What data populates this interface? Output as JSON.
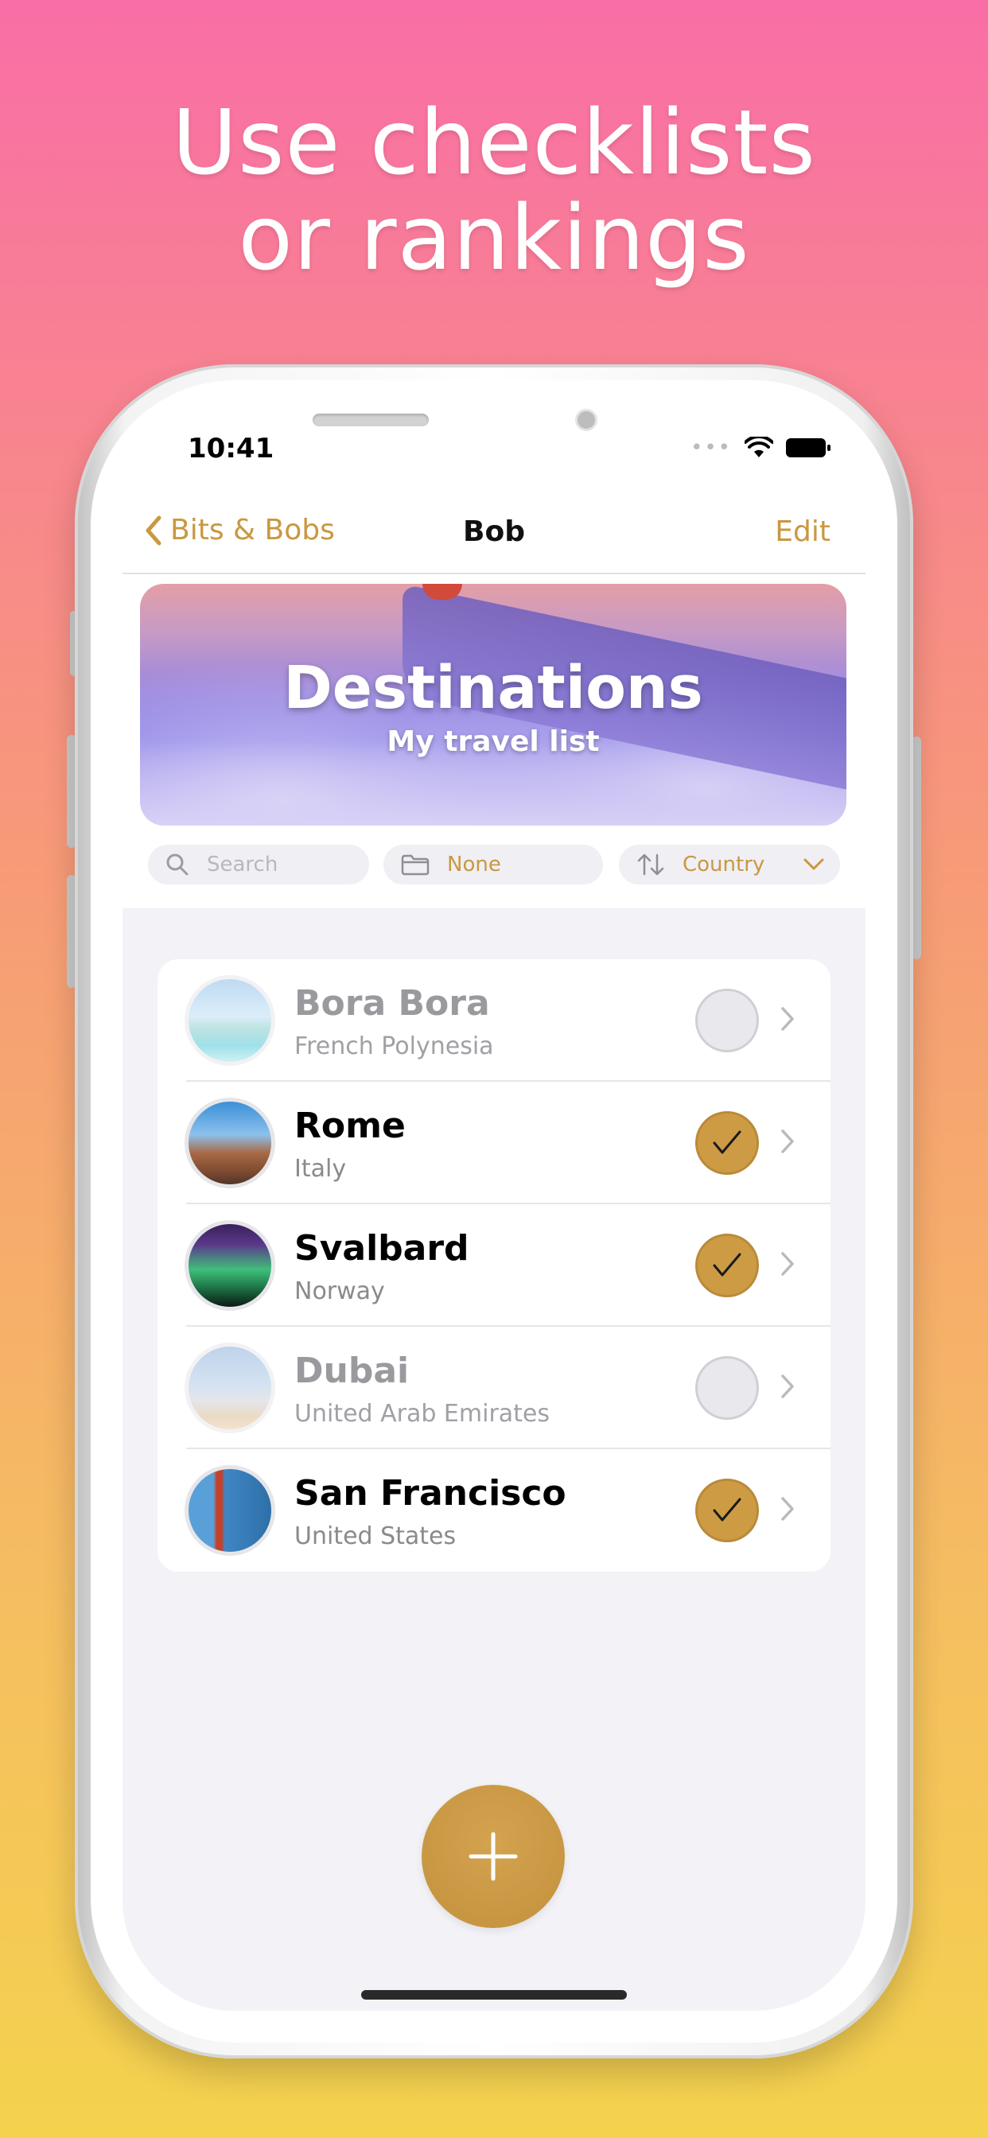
{
  "headline": {
    "line1": "Use checklists",
    "line2": "or rankings"
  },
  "status_bar": {
    "time": "10:41"
  },
  "nav": {
    "back_label": "Bits & Bobs",
    "title": "Bob",
    "edit_label": "Edit"
  },
  "banner": {
    "title": "Destinations",
    "subtitle": "My travel list"
  },
  "controls": {
    "search_placeholder": "Search",
    "group_label": "None",
    "sort_label": "Country"
  },
  "items": [
    {
      "name": "Bora Bora",
      "subtitle": "French Polynesia",
      "checked": false,
      "icon": "beach-photo"
    },
    {
      "name": "Rome",
      "subtitle": "Italy",
      "checked": true,
      "icon": "colosseum-photo"
    },
    {
      "name": "Svalbard",
      "subtitle": "Norway",
      "checked": true,
      "icon": "aurora-photo"
    },
    {
      "name": "Dubai",
      "subtitle": "United Arab Emirates",
      "checked": false,
      "icon": "skyline-photo"
    },
    {
      "name": "San Francisco",
      "subtitle": "United States",
      "checked": true,
      "icon": "golden-gate-photo"
    }
  ],
  "colors": {
    "accent": "#CE9B45",
    "background_top": "#F96EA6",
    "background_bottom": "#F4D24D"
  }
}
